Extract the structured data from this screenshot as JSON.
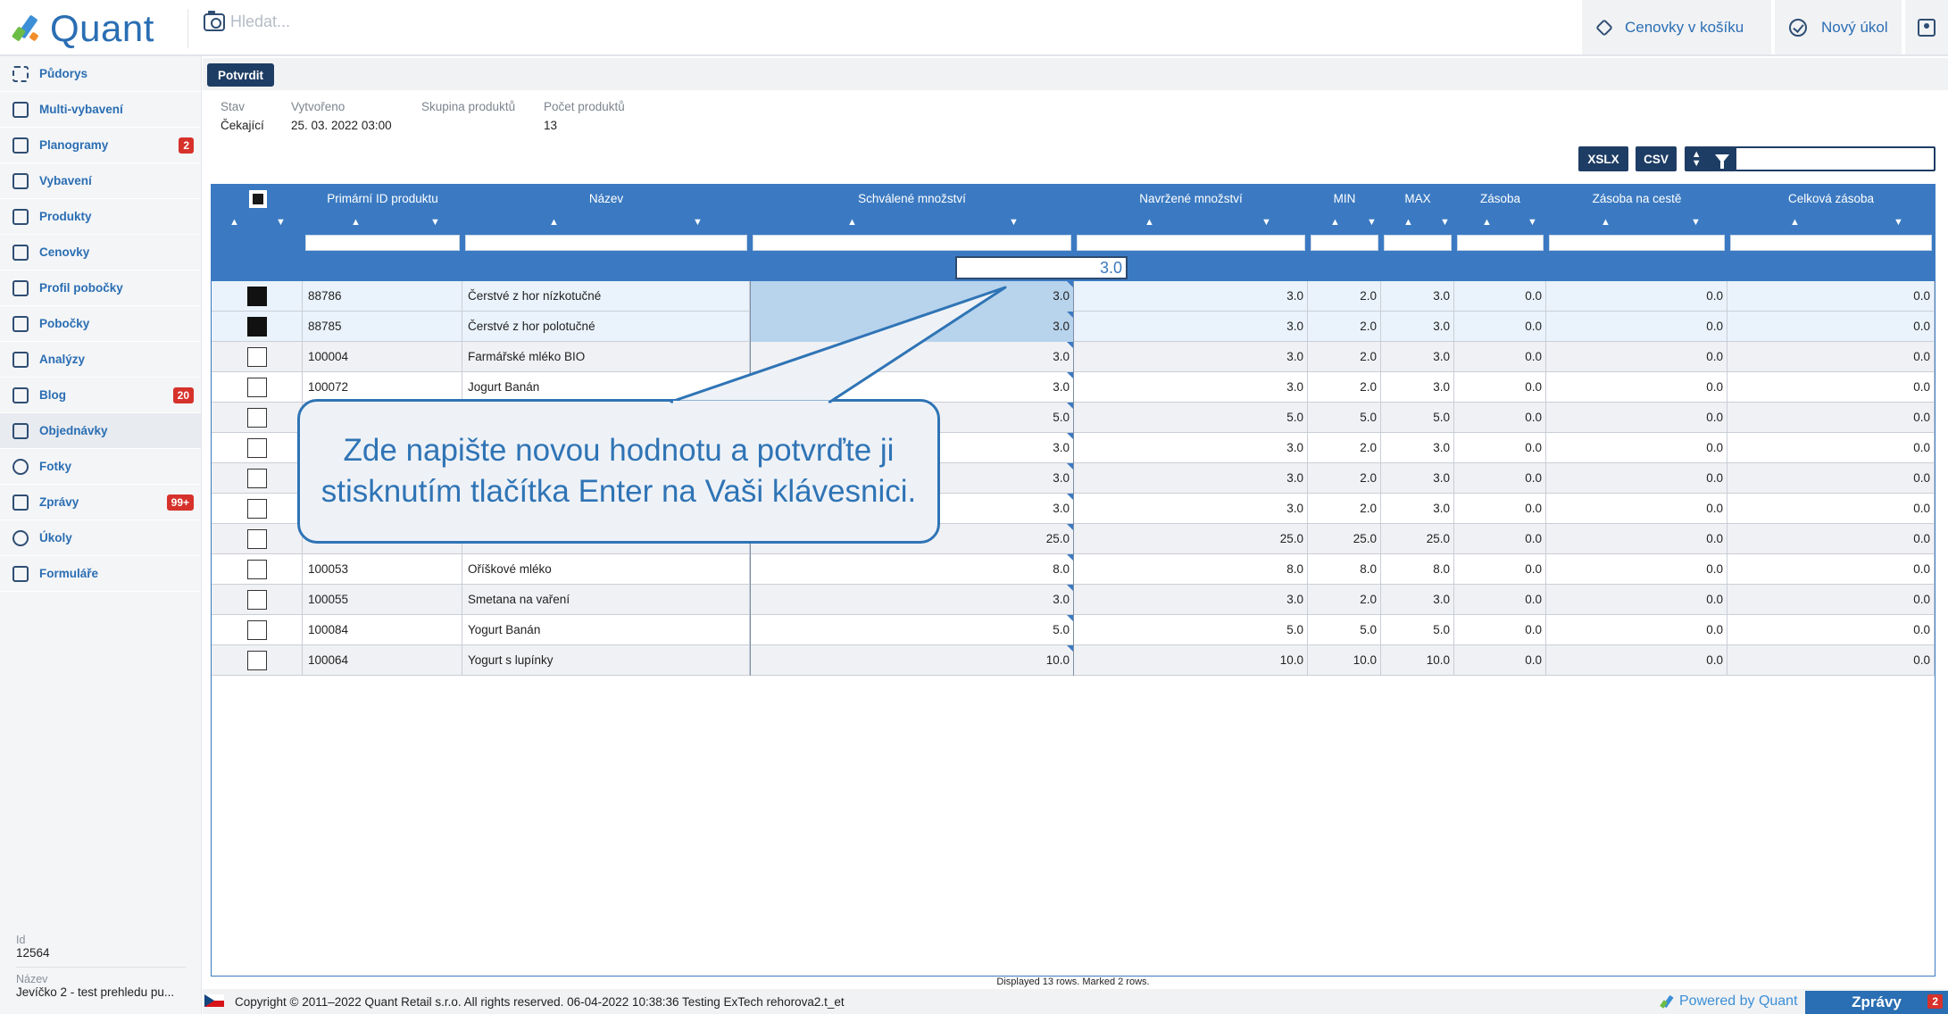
{
  "header": {
    "logo_text": "Quant",
    "search_placeholder": "Hledat...",
    "cenovky_label": "Cenovky v košíku",
    "novy_ukol_label": "Nový úkol"
  },
  "sidebar": {
    "items": [
      {
        "label": "Půdorys",
        "icon": "floorplan-icon"
      },
      {
        "label": "Multi-vybavení",
        "icon": "multi-equipment-icon"
      },
      {
        "label": "Planogramy",
        "icon": "planogram-icon",
        "badge": "2"
      },
      {
        "label": "Vybavení",
        "icon": "equipment-icon"
      },
      {
        "label": "Produkty",
        "icon": "products-icon"
      },
      {
        "label": "Cenovky",
        "icon": "tag-icon"
      },
      {
        "label": "Profil pobočky",
        "icon": "info-icon"
      },
      {
        "label": "Pobočky",
        "icon": "home-icon"
      },
      {
        "label": "Analýzy",
        "icon": "chart-icon"
      },
      {
        "label": "Blog",
        "icon": "edit-icon",
        "badge": "20"
      },
      {
        "label": "Objednávky",
        "icon": "orders-icon",
        "active": true
      },
      {
        "label": "Fotky",
        "icon": "photo-icon"
      },
      {
        "label": "Zprávy",
        "icon": "messages-icon",
        "badge": "99+"
      },
      {
        "label": "Úkoly",
        "icon": "check-icon"
      },
      {
        "label": "Formuláře",
        "icon": "form-icon"
      }
    ],
    "info": {
      "id_label": "Id",
      "id_value": "12564",
      "name_label": "Název",
      "name_value": "Jevíčko 2 - test prehledu pu..."
    }
  },
  "toolbar": {
    "confirm_label": "Potvrdit",
    "xlsx_label": "XSLX",
    "csv_label": "CSV"
  },
  "meta": {
    "stav_label": "Stav",
    "stav_value": "Čekající",
    "vytvoreno_label": "Vytvořeno",
    "vytvoreno_value": "25. 03. 2022 03:00",
    "skupina_label": "Skupina produktů",
    "skupina_value": "",
    "pocet_label": "Počet produktů",
    "pocet_value": "13"
  },
  "table": {
    "columns": [
      "Primární ID produktu",
      "Název",
      "Schválené množství",
      "Navržené množství",
      "MIN",
      "MAX",
      "Zásoba",
      "Zásoba na cestě",
      "Celková zásoba"
    ],
    "edit_value": "3.0",
    "rows": [
      {
        "checked": true,
        "id": "88786",
        "name": "Čerstvé z hor nízkotučné",
        "approved": "3.0",
        "proposed": "3.0",
        "min": "2.0",
        "max": "3.0",
        "stock": "0.0",
        "transit": "0.0",
        "total": "0.0"
      },
      {
        "checked": true,
        "id": "88785",
        "name": "Čerstvé z hor polotučné",
        "approved": "3.0",
        "proposed": "3.0",
        "min": "2.0",
        "max": "3.0",
        "stock": "0.0",
        "transit": "0.0",
        "total": "0.0"
      },
      {
        "checked": false,
        "id": "100004",
        "name": "Farmářské mléko BIO",
        "approved": "3.0",
        "proposed": "3.0",
        "min": "2.0",
        "max": "3.0",
        "stock": "0.0",
        "transit": "0.0",
        "total": "0.0"
      },
      {
        "checked": false,
        "id": "100072",
        "name": "Jogurt Banán",
        "approved": "3.0",
        "proposed": "3.0",
        "min": "2.0",
        "max": "3.0",
        "stock": "0.0",
        "transit": "0.0",
        "total": "0.0"
      },
      {
        "checked": false,
        "id": "",
        "name": "",
        "approved": "5.0",
        "proposed": "5.0",
        "min": "5.0",
        "max": "5.0",
        "stock": "0.0",
        "transit": "0.0",
        "total": "0.0"
      },
      {
        "checked": false,
        "id": "",
        "name": "",
        "approved": "3.0",
        "proposed": "3.0",
        "min": "2.0",
        "max": "3.0",
        "stock": "0.0",
        "transit": "0.0",
        "total": "0.0"
      },
      {
        "checked": false,
        "id": "",
        "name": "",
        "approved": "3.0",
        "proposed": "3.0",
        "min": "2.0",
        "max": "3.0",
        "stock": "0.0",
        "transit": "0.0",
        "total": "0.0"
      },
      {
        "checked": false,
        "id": "",
        "name": "",
        "approved": "3.0",
        "proposed": "3.0",
        "min": "2.0",
        "max": "3.0",
        "stock": "0.0",
        "transit": "0.0",
        "total": "0.0"
      },
      {
        "checked": false,
        "id": "",
        "name": "",
        "approved": "25.0",
        "proposed": "25.0",
        "min": "25.0",
        "max": "25.0",
        "stock": "0.0",
        "transit": "0.0",
        "total": "0.0"
      },
      {
        "checked": false,
        "id": "100053",
        "name": "Oříškové mléko",
        "approved": "8.0",
        "proposed": "8.0",
        "min": "8.0",
        "max": "8.0",
        "stock": "0.0",
        "transit": "0.0",
        "total": "0.0"
      },
      {
        "checked": false,
        "id": "100055",
        "name": "Smetana na vaření",
        "approved": "3.0",
        "proposed": "3.0",
        "min": "2.0",
        "max": "3.0",
        "stock": "0.0",
        "transit": "0.0",
        "total": "0.0"
      },
      {
        "checked": false,
        "id": "100084",
        "name": "Yogurt Banán",
        "approved": "5.0",
        "proposed": "5.0",
        "min": "5.0",
        "max": "5.0",
        "stock": "0.0",
        "transit": "0.0",
        "total": "0.0"
      },
      {
        "checked": false,
        "id": "100064",
        "name": "Yogurt s lupínky",
        "approved": "10.0",
        "proposed": "10.0",
        "min": "10.0",
        "max": "10.0",
        "stock": "0.0",
        "transit": "0.0",
        "total": "0.0"
      }
    ],
    "status_text": "Displayed 13 rows. Marked 2 rows."
  },
  "callout": {
    "text": "Zde napište novou hodnotu a potvrďte ji stisknutím tlačítka Enter na Vaši klávesnici."
  },
  "footer": {
    "copyright": "Copyright © 2011–2022 Quant Retail s.r.o. All rights reserved. 06-04-2022 10:38:36  Testing ExTech  rehorova2.t_et",
    "powered": "Powered by Quant",
    "zpravy_label": "Zprávy",
    "zpravy_badge": "2"
  },
  "colors": {
    "brand": "#2a6eb3",
    "grid_header": "#3b7ac2",
    "dark_button": "#1e3d64",
    "badge": "#d6322b"
  }
}
